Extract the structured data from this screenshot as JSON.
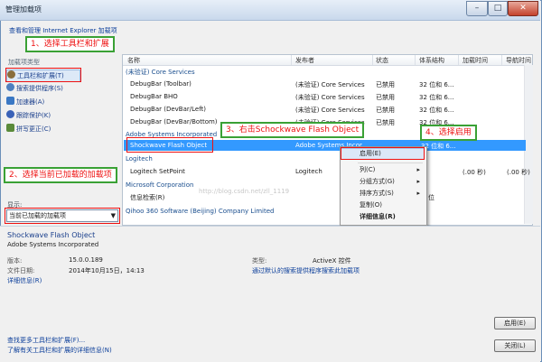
{
  "window": {
    "title": "管理加载项",
    "minimize": "–",
    "maximize": "□",
    "close": "✕"
  },
  "header": {
    "link": "查看和管理 Internet Explorer 加载项"
  },
  "sidebar": {
    "heading": "加载项类型",
    "items": [
      {
        "label": "工具栏和扩展(T)",
        "icon": "gear-icon",
        "color": "#8a6d3b"
      },
      {
        "label": "搜索提供程序(S)",
        "icon": "search-icon",
        "color": "#4f7fbf"
      },
      {
        "label": "加速器(A)",
        "icon": "accelerator-icon",
        "color": "#3a78c4"
      },
      {
        "label": "跟踪保护(K)",
        "icon": "block-icon",
        "color": "#3a62b8"
      },
      {
        "label": "拼写更正(C)",
        "icon": "spelling-icon",
        "color": "#5a8a3a"
      }
    ],
    "show_label": "显示:",
    "show_value": "当前已加载的加载项"
  },
  "list": {
    "columns": [
      "名称",
      "发布者",
      "状态",
      "体系结构",
      "加载时间",
      "导航时间"
    ],
    "groups": [
      {
        "name": "(未验证) Core Services",
        "rows": [
          [
            "DebugBar (Toolbar)",
            "(未验证) Core Services",
            "已禁用",
            "32 位和 6..."
          ],
          [
            "DebugBar BHO",
            "(未验证) Core Services",
            "已禁用",
            "32 位和 6..."
          ],
          [
            "DebugBar (DevBar/Left)",
            "(未验证) Core Services",
            "已禁用",
            "32 位和 6..."
          ],
          [
            "DebugBar (DevBar/Bottom)",
            "(未验证) Core Services",
            "已禁用",
            "32 位和 6..."
          ]
        ]
      },
      {
        "name": "Adobe Systems Incorporated",
        "rows": [
          [
            "Shockwave Flash Object",
            "Adobe Systems Incor...",
            "已禁用",
            "32 位和 6..."
          ]
        ]
      },
      {
        "name": "Logitech",
        "rows": [
          [
            "Logitech SetPoint",
            "Logitech",
            "",
            "",
            "(.00 秒)",
            "(.00 秒)"
          ]
        ]
      },
      {
        "name": "Microsoft Corporation",
        "rows": [
          [
            "信息检索(R)",
            "",
            "",
            "位"
          ]
        ]
      },
      {
        "name": "Qihoo 360 Software (Beijing) Company Limited",
        "rows": []
      }
    ],
    "watermark": "http://blog.csdn.net/zll_1119"
  },
  "context_menu": {
    "items": [
      {
        "label": "启用(E)",
        "submenu": false,
        "highlighted": true
      },
      {
        "label": "列(C)",
        "submenu": true
      },
      {
        "label": "分组方式(G)",
        "submenu": true
      },
      {
        "label": "排序方式(S)",
        "submenu": true
      },
      {
        "label": "复制(O)",
        "submenu": false
      },
      {
        "label": "详细信息(R)",
        "submenu": false
      }
    ]
  },
  "details": {
    "name": "Shockwave Flash Object",
    "publisher": "Adobe Systems Incorporated",
    "version_label": "版本:",
    "version_value": "15.0.0.189",
    "date_label": "文件日期:",
    "date_value": "2014年10月15日，14:13",
    "more_info": "详细信息(R)",
    "type_label": "类型:",
    "type_value": "ActiveX 控件",
    "search_link": "通过默认的搜索提供程序搜索此加载项"
  },
  "footer": {
    "find_more": "查找更多工具栏和扩展(F)...",
    "learn_more": "了解有关工具栏和扩展的详细信息(N)",
    "enable_button": "启用(E)",
    "close_button": "关闭(L)"
  },
  "annotations": {
    "step1": "1、选择工具栏和扩展",
    "step2": "2、选择当前已加载的加载项",
    "step3": "3、右击Schockwave Flash Object",
    "step4": "4、选择启用"
  }
}
